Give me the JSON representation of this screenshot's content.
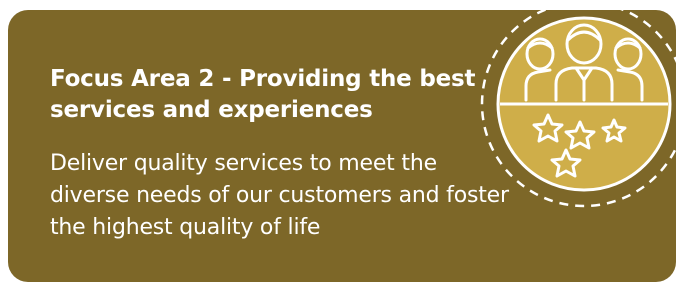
{
  "card": {
    "title": "Focus Area 2 - Providing the best services and experiences",
    "description": "Deliver quality services to meet the diverse needs of our customers and foster the highest quality of life"
  },
  "emblem": {
    "icon": "people-with-stars-icon"
  },
  "colors": {
    "card_background": "#7d6728",
    "emblem_gold": "#cfae49",
    "emblem_outline": "#ffffff"
  }
}
